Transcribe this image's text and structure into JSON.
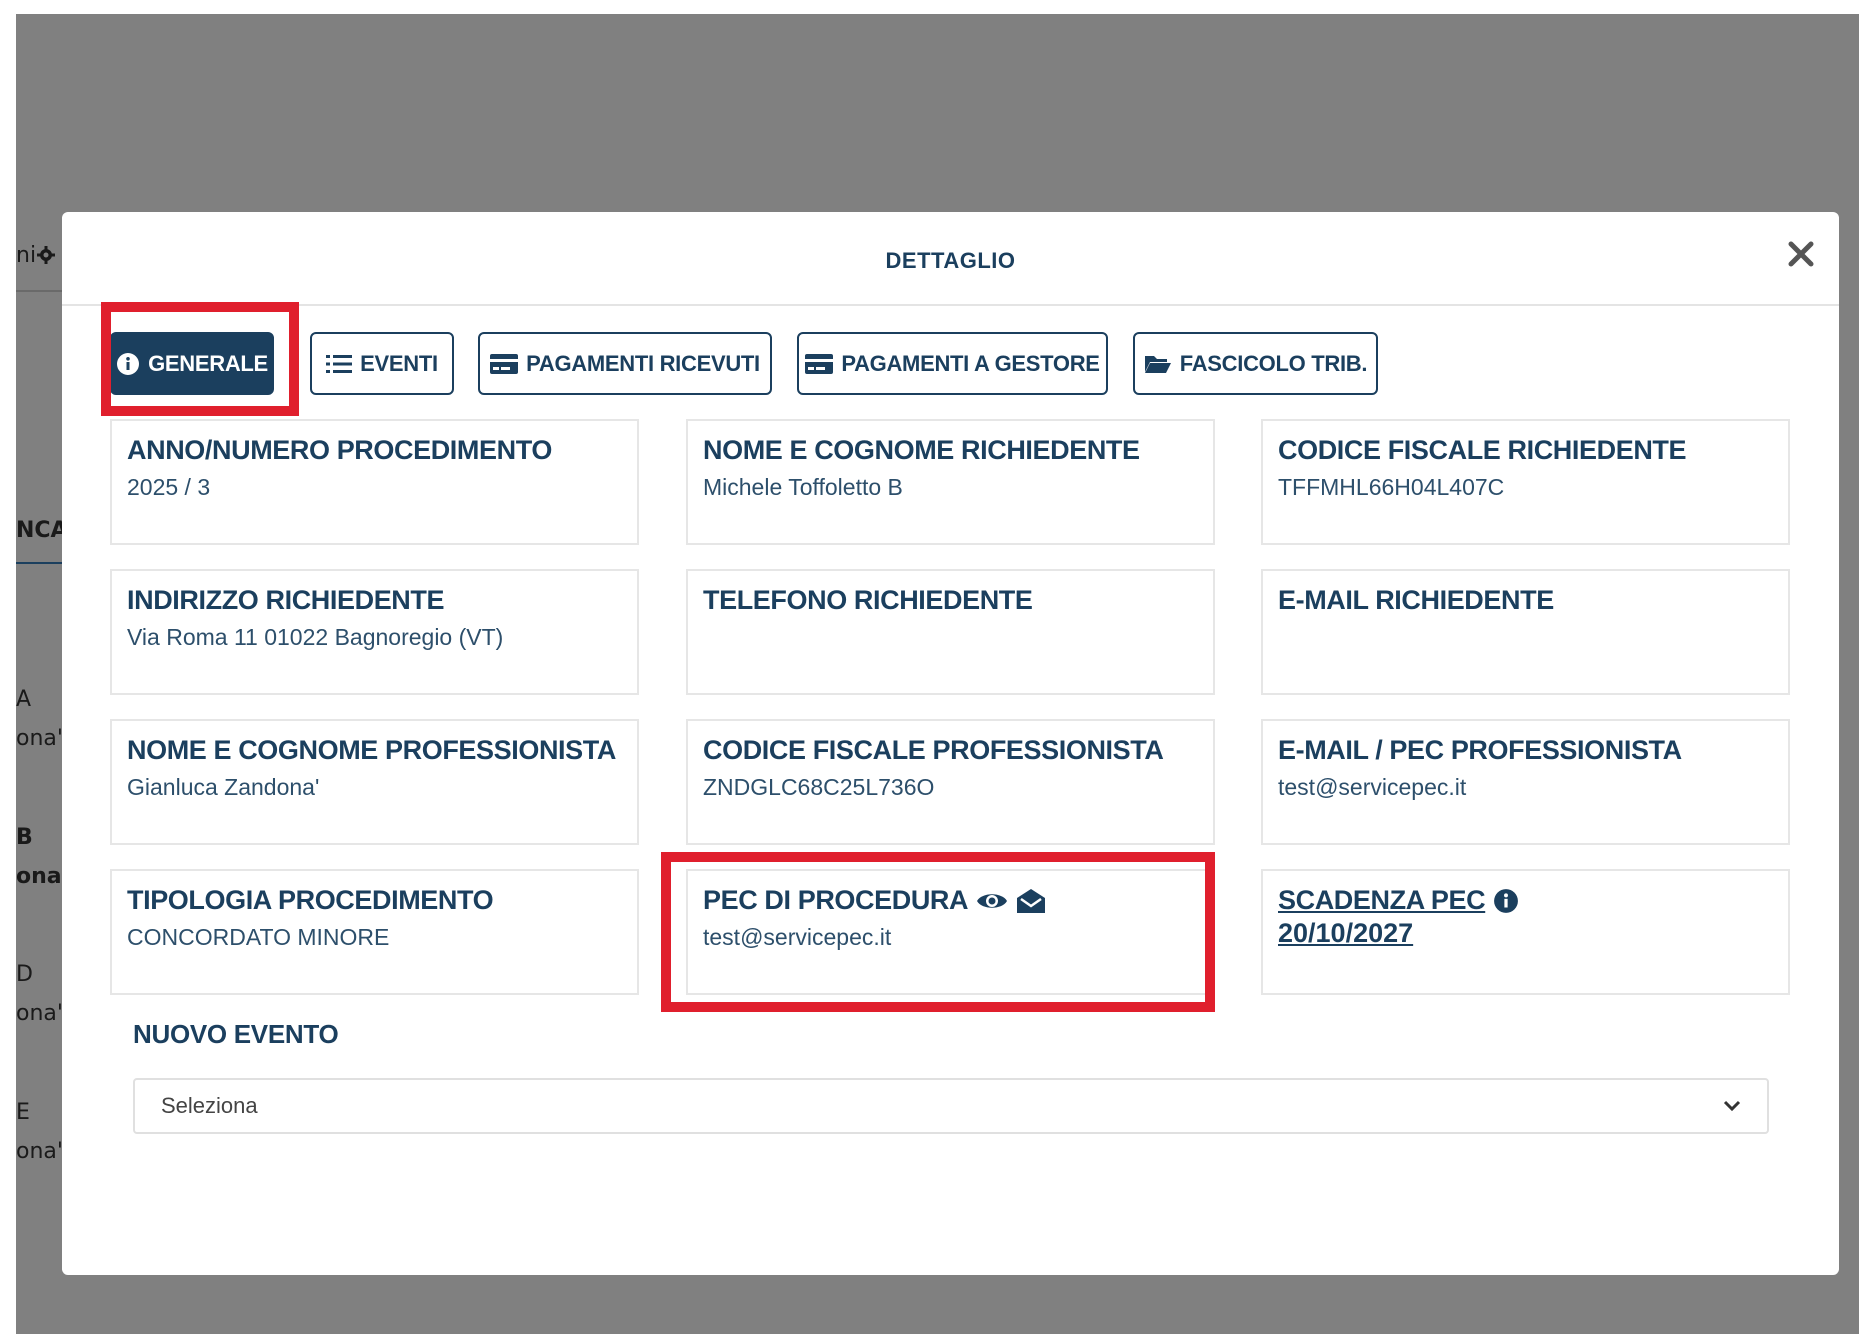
{
  "background_fragments": [
    {
      "text": "ni",
      "bold": false
    },
    {
      "text": "NCA",
      "bold": true
    },
    {
      "text": "A",
      "bold": false
    },
    {
      "text": "ona'",
      "bold": false
    },
    {
      "text": "B",
      "bold": true
    },
    {
      "text": "ona'",
      "bold": true
    },
    {
      "text": "D",
      "bold": false
    },
    {
      "text": "ona'",
      "bold": false
    },
    {
      "text": "E",
      "bold": false
    },
    {
      "text": "ona'",
      "bold": false
    }
  ],
  "modal": {
    "title": "DETTAGLIO",
    "close_icon": "close-icon"
  },
  "tabs": [
    {
      "label": "GENERALE",
      "icon": "info-circle-icon",
      "active": true
    },
    {
      "label": "EVENTI",
      "icon": "list-icon",
      "active": false
    },
    {
      "label": "PAGAMENTI RICEVUTI",
      "icon": "credit-card-icon",
      "active": false
    },
    {
      "label": "PAGAMENTI A GESTORE",
      "icon": "credit-card-icon",
      "active": false
    },
    {
      "label": "FASCICOLO TRIB.",
      "icon": "folder-open-icon",
      "active": false
    }
  ],
  "cards": {
    "anno_numero": {
      "label": "ANNO/NUMERO PROCEDIMENTO",
      "value": "2025 / 3"
    },
    "nome_richiedente": {
      "label": "NOME E COGNOME RICHIEDENTE",
      "value": "Michele Toffoletto B"
    },
    "cf_richiedente": {
      "label": "CODICE FISCALE RICHIEDENTE",
      "value": "TFFMHL66H04L407C"
    },
    "indirizzo_richiedente": {
      "label": "INDIRIZZO RICHIEDENTE",
      "value": "Via Roma 11 01022 Bagnoregio (VT)"
    },
    "telefono_richiedente": {
      "label": "TELEFONO RICHIEDENTE",
      "value": ""
    },
    "email_richiedente": {
      "label": "E-MAIL RICHIEDENTE",
      "value": ""
    },
    "nome_professionista": {
      "label": "NOME E COGNOME PROFESSIONISTA",
      "value": "Gianluca Zandona'"
    },
    "cf_professionista": {
      "label": "CODICE FISCALE PROFESSIONISTA",
      "value": "ZNDGLC68C25L736O"
    },
    "email_professionista": {
      "label": "E-MAIL / PEC PROFESSIONISTA",
      "value": "test@servicepec.it"
    },
    "tipologia": {
      "label": "TIPOLOGIA PROCEDIMENTO",
      "value": "CONCORDATO MINORE"
    },
    "pec_procedura": {
      "label": "PEC DI PROCEDURA",
      "value": "test@servicepec.it",
      "icons": [
        "eye-icon",
        "envelope-open-icon"
      ]
    },
    "scadenza_pec": {
      "label": "SCADENZA PEC",
      "value": "20/10/2027",
      "icon": "info-circle-icon"
    }
  },
  "nuovo_evento": {
    "title": "NUOVO EVENTO",
    "select_value": "Seleziona"
  },
  "colors": {
    "primary": "#1b3f5e",
    "highlight": "#e01f2d",
    "backdrop": "#808080"
  }
}
